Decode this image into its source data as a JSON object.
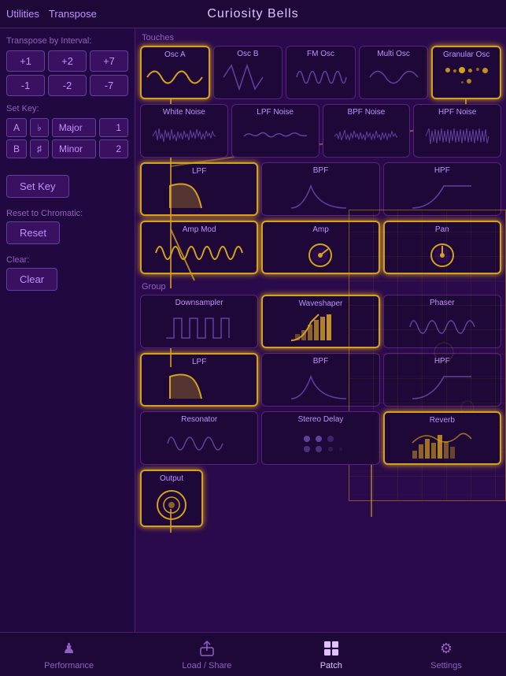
{
  "header": {
    "title": "Curiosity Bells",
    "nav_left": [
      "Utilities",
      "Transpose"
    ]
  },
  "sidebar": {
    "transpose_label": "Transpose by Interval:",
    "interval_buttons": [
      "+1",
      "+2",
      "+7",
      "-1",
      "-2",
      "-7"
    ],
    "set_key_label": "Set Key:",
    "key_rows": [
      {
        "note": "A",
        "sharp": "♭",
        "scale": "Major",
        "num": "1"
      },
      {
        "note": "B",
        "sharp": "♯",
        "scale": "Minor",
        "num": "2"
      }
    ],
    "set_key_btn": "Set Key",
    "reset_label": "Reset to Chromatic:",
    "reset_btn": "Reset",
    "clear_label": "Clear:",
    "clear_btn": "Clear"
  },
  "touches_section": {
    "label": "Touches",
    "modules_row1": [
      {
        "id": "osc-a",
        "label": "Osc A",
        "active": true
      },
      {
        "id": "osc-b",
        "label": "Osc B",
        "active": false
      },
      {
        "id": "fm-osc",
        "label": "FM Osc",
        "active": false
      },
      {
        "id": "multi-osc",
        "label": "Multi Osc",
        "active": false
      },
      {
        "id": "granular-osc",
        "label": "Granular Osc",
        "active": true
      }
    ],
    "modules_row2": [
      {
        "id": "white-noise",
        "label": "White Noise",
        "active": false
      },
      {
        "id": "lpf-noise",
        "label": "LPF Noise",
        "active": false
      },
      {
        "id": "bpf-noise",
        "label": "BPF Noise",
        "active": false
      },
      {
        "id": "hpf-noise",
        "label": "HPF Noise",
        "active": false
      }
    ]
  },
  "filter_section": {
    "modules": [
      {
        "id": "lpf-1",
        "label": "LPF",
        "active": true
      },
      {
        "id": "bpf-1",
        "label": "BPF",
        "active": false
      },
      {
        "id": "hpf-1",
        "label": "HPF",
        "active": false
      }
    ]
  },
  "amp_section": {
    "modules": [
      {
        "id": "amp-mod",
        "label": "Amp Mod",
        "active": true
      },
      {
        "id": "amp",
        "label": "Amp",
        "active": true
      },
      {
        "id": "pan",
        "label": "Pan",
        "active": true
      }
    ]
  },
  "group_section": {
    "label": "Group",
    "modules": [
      {
        "id": "downsampler",
        "label": "Downsampler",
        "active": false
      },
      {
        "id": "waveshaper",
        "label": "Waveshaper",
        "active": true
      },
      {
        "id": "phaser",
        "label": "Phaser",
        "active": false
      }
    ]
  },
  "filter2_section": {
    "modules": [
      {
        "id": "lpf-2",
        "label": "LPF",
        "active": true
      },
      {
        "id": "bpf-2",
        "label": "BPF",
        "active": false
      },
      {
        "id": "hpf-2",
        "label": "HPF",
        "active": false
      }
    ]
  },
  "effects_section": {
    "modules": [
      {
        "id": "resonator",
        "label": "Resonator",
        "active": false
      },
      {
        "id": "stereo-delay",
        "label": "Stereo Delay",
        "active": false
      },
      {
        "id": "reverb",
        "label": "Reverb",
        "active": true
      }
    ]
  },
  "output_section": {
    "label": "Output",
    "active": true
  },
  "bottom_nav": {
    "items": [
      {
        "id": "performance",
        "label": "Performance",
        "active": false,
        "icon": "♟"
      },
      {
        "id": "load-share",
        "label": "Load / Share",
        "active": false,
        "icon": "⬆"
      },
      {
        "id": "patch",
        "label": "Patch",
        "active": true,
        "icon": "⊞"
      },
      {
        "id": "settings",
        "label": "Settings",
        "active": false,
        "icon": "⚙"
      }
    ]
  },
  "colors": {
    "gold": "#d4a020",
    "purple_dark": "#2a0a4a",
    "purple_mid": "#5a2080",
    "purple_light": "#c090ff"
  }
}
